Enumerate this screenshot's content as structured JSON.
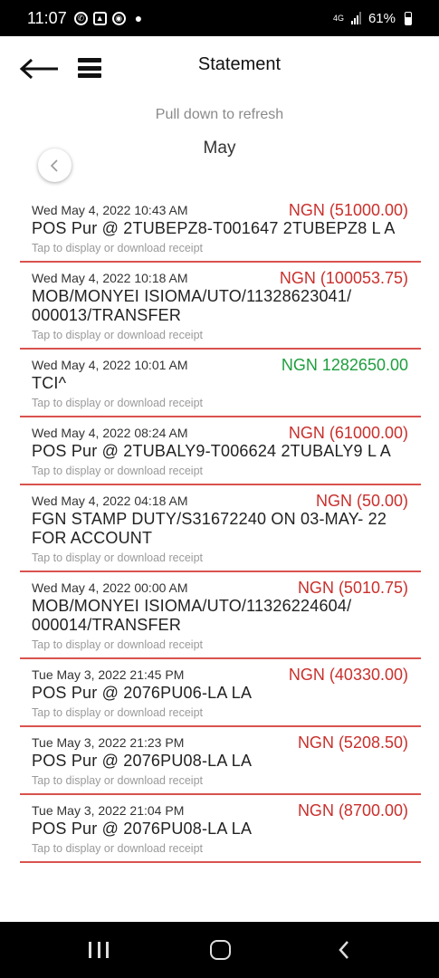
{
  "status_bar": {
    "time": "11:07",
    "network": "4G",
    "battery": "61%"
  },
  "header": {
    "title": "Statement"
  },
  "refresh_hint": "Pull down to refresh",
  "month": "May",
  "transactions": [
    {
      "date": "Wed May 4, 2022 10:43 AM",
      "amount": "NGN (51000.00)",
      "type": "debit",
      "description": "POS Pur @ 2TUBEPZ8-T001647 2TUBEPZ8 L A",
      "hint": "Tap to display or download receipt"
    },
    {
      "date": "Wed May 4, 2022 10:18 AM",
      "amount": "NGN (100053.75)",
      "type": "debit",
      "description": "MOB/MONYEI ISIOMA/UTO/11328623041/ 000013/TRANSFER",
      "hint": "Tap to display or download receipt"
    },
    {
      "date": "Wed May 4, 2022 10:01 AM",
      "amount": "NGN 1282650.00",
      "type": "credit",
      "description": "TCI^",
      "hint": "Tap to display or download receipt"
    },
    {
      "date": "Wed May 4, 2022 08:24 AM",
      "amount": "NGN (61000.00)",
      "type": "debit",
      "description": "POS Pur @ 2TUBALY9-T006624 2TUBALY9 L A",
      "hint": "Tap to display or download receipt"
    },
    {
      "date": "Wed May 4, 2022 04:18 AM",
      "amount": "NGN (50.00)",
      "type": "debit",
      "description": "FGN STAMP DUTY/S31672240 ON 03-MAY- 22 FOR ACCOUNT",
      "hint": "Tap to display or download receipt"
    },
    {
      "date": "Wed May 4, 2022 00:00 AM",
      "amount": "NGN (5010.75)",
      "type": "debit",
      "description": "MOB/MONYEI ISIOMA/UTO/11326224604/ 000014/TRANSFER",
      "hint": "Tap to display or download receipt"
    },
    {
      "date": "Tue May 3, 2022 21:45 PM",
      "amount": "NGN (40330.00)",
      "type": "debit",
      "description": "POS Pur @ 2076PU06-LA LA",
      "hint": "Tap to display or download receipt"
    },
    {
      "date": "Tue May 3, 2022 21:23 PM",
      "amount": "NGN (5208.50)",
      "type": "debit",
      "description": "POS Pur @ 2076PU08-LA LA",
      "hint": "Tap to display or download receipt"
    },
    {
      "date": "Tue May 3, 2022 21:04 PM",
      "amount": "NGN (8700.00)",
      "type": "debit",
      "description": "POS Pur @ 2076PU08-LA LA",
      "hint": "Tap to display or download receipt"
    }
  ]
}
